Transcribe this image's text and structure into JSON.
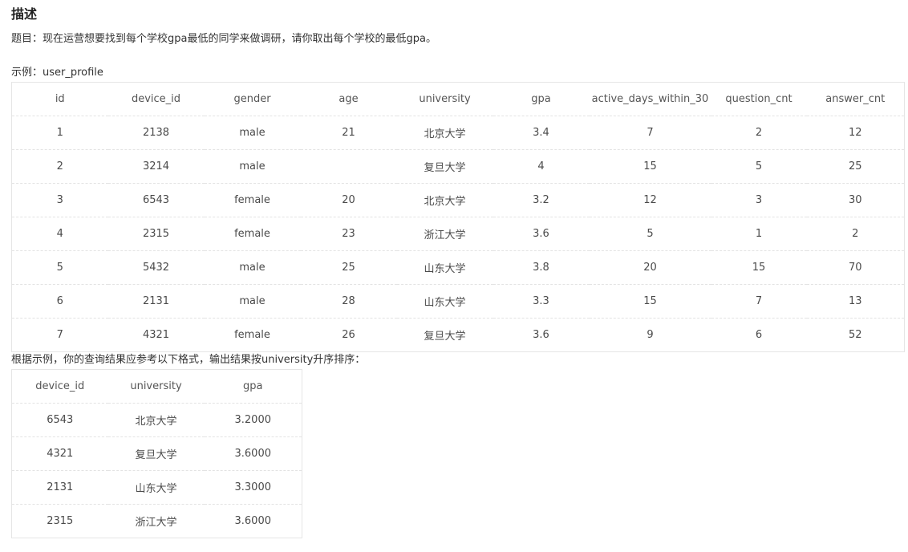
{
  "heading": "描述",
  "question": "题目：现在运营想要找到每个学校gpa最低的同学来做调研，请你取出每个学校的最低gpa。",
  "example_label": "示例：user_profile",
  "table1": {
    "headers": [
      "id",
      "device_id",
      "gender",
      "age",
      "university",
      "gpa",
      "active_days_within_30",
      "question_cnt",
      "answer_cnt"
    ],
    "rows": [
      [
        "1",
        "2138",
        "male",
        "21",
        "北京大学",
        "3.4",
        "7",
        "2",
        "12"
      ],
      [
        "2",
        "3214",
        "male",
        "",
        "复旦大学",
        "4",
        "15",
        "5",
        "25"
      ],
      [
        "3",
        "6543",
        "female",
        "20",
        "北京大学",
        "3.2",
        "12",
        "3",
        "30"
      ],
      [
        "4",
        "2315",
        "female",
        "23",
        "浙江大学",
        "3.6",
        "5",
        "1",
        "2"
      ],
      [
        "5",
        "5432",
        "male",
        "25",
        "山东大学",
        "3.8",
        "20",
        "15",
        "70"
      ],
      [
        "6",
        "2131",
        "male",
        "28",
        "山东大学",
        "3.3",
        "15",
        "7",
        "13"
      ],
      [
        "7",
        "4321",
        "female",
        "26",
        "复旦大学",
        "3.6",
        "9",
        "6",
        "52"
      ]
    ]
  },
  "result_label": "根据示例，你的查询结果应参考以下格式，输出结果按university升序排序：",
  "table2": {
    "headers": [
      "device_id",
      "university",
      "gpa"
    ],
    "rows": [
      [
        "6543",
        "北京大学",
        "3.2000"
      ],
      [
        "4321",
        "复旦大学",
        "3.6000"
      ],
      [
        "2131",
        "山东大学",
        "3.3000"
      ],
      [
        "2315",
        "浙江大学",
        "3.6000"
      ]
    ]
  }
}
